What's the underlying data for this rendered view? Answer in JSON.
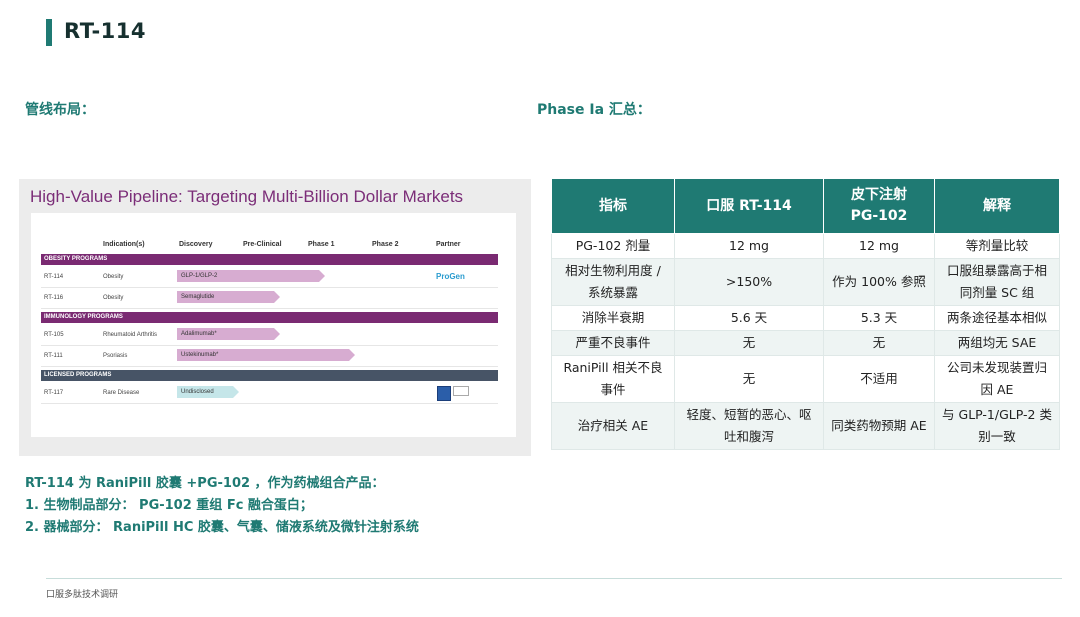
{
  "page": {
    "title": "RT-114",
    "pipeline_label": "管线布局：",
    "phase_label": "Phase Ia 汇总：",
    "footer": "口服多肽技术调研"
  },
  "pipeline_image": {
    "heading": "High-Value Pipeline: Targeting Multi-Billion Dollar Markets",
    "columns": [
      "Indication(s)",
      "Discovery",
      "Pre-Clinical",
      "Phase 1",
      "Phase 2",
      "Partner"
    ],
    "sections": [
      {
        "name": "OBESITY PROGRAMS",
        "rows": [
          {
            "code": "RT-114",
            "indication": "Obesity",
            "asset": "GLP-1/GLP-2",
            "partner": "ProGen"
          },
          {
            "code": "RT-116",
            "indication": "Obesity",
            "asset": "Semaglutide",
            "partner": ""
          }
        ]
      },
      {
        "name": "IMMUNOLOGY PROGRAMS",
        "rows": [
          {
            "code": "RT-105",
            "indication": "Rheumatoid Arthritis",
            "asset": "Adalimumab*",
            "partner": ""
          },
          {
            "code": "RT-111",
            "indication": "Psoriasis",
            "asset": "Ustekinumab*",
            "partner": ""
          }
        ]
      },
      {
        "name": "LICENSED PROGRAMS",
        "rows": [
          {
            "code": "RT-117",
            "indication": "Rare Disease",
            "asset": "Undisclosed",
            "partner": ""
          }
        ]
      }
    ]
  },
  "description": {
    "line1": "RT-114 为 RaniPill 胶囊 +PG-102 ，作为药械组合产品：",
    "line2": "1. 生物制品部分： PG-102 重组 Fc 融合蛋白；",
    "line3": "2. 器械部分： RaniPill HC 胶囊、气囊、储液系统及微针注射系统"
  },
  "phase_table": {
    "headers": [
      "指标",
      "口服 RT-114",
      "皮下注射\nPG-102",
      "解释"
    ],
    "rows": [
      [
        "PG-102 剂量",
        "12 mg",
        "12 mg",
        "等剂量比较"
      ],
      [
        "相对生物利用度 / 系统暴露",
        ">150%",
        "作为 100% 参照",
        "口服组暴露高于相同剂量 SC 组"
      ],
      [
        "消除半衰期",
        "5.6 天",
        "5.3 天",
        "两条途径基本相似"
      ],
      [
        "严重不良事件",
        "无",
        "无",
        "两组均无 SAE"
      ],
      [
        "RaniPill 相关不良事件",
        "无",
        "不适用",
        "公司未发现装置归因 AE"
      ],
      [
        "治疗相关 AE",
        "轻度、短暂的恶心、呕吐和腹泻",
        "同类药物预期 AE",
        "与 GLP-1/GLP-2 类别一致"
      ]
    ]
  }
}
